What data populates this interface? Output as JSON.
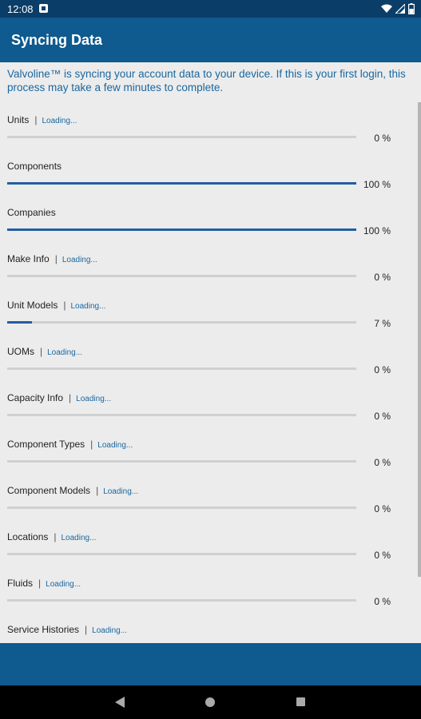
{
  "status": {
    "time": "12:08"
  },
  "header": {
    "title": "Syncing Data"
  },
  "intro": "Valvoline™ is syncing your account data to your device. If this is your first login, this process may take a few minutes to complete.",
  "colors": {
    "primary": "#0f5a8e",
    "status_bar": "#0a3d68",
    "progress": "#225ea1",
    "link_text": "#1a67a0"
  },
  "items": [
    {
      "name": "Units",
      "loading": "Loading...",
      "percent_text": "0 %",
      "progress": 0
    },
    {
      "name": "Components",
      "loading": "",
      "percent_text": "100 %",
      "progress": 100
    },
    {
      "name": "Companies",
      "loading": "",
      "percent_text": "100 %",
      "progress": 100
    },
    {
      "name": "Make Info",
      "loading": "Loading...",
      "percent_text": "0 %",
      "progress": 0
    },
    {
      "name": "Unit Models",
      "loading": "Loading...",
      "percent_text": "7 %",
      "progress": 7
    },
    {
      "name": "UOMs",
      "loading": "Loading...",
      "percent_text": "0 %",
      "progress": 0
    },
    {
      "name": "Capacity Info",
      "loading": "Loading...",
      "percent_text": "0 %",
      "progress": 0
    },
    {
      "name": "Component Types",
      "loading": "Loading...",
      "percent_text": "0 %",
      "progress": 0
    },
    {
      "name": "Component Models",
      "loading": "Loading...",
      "percent_text": "0 %",
      "progress": 0
    },
    {
      "name": "Locations",
      "loading": "Loading...",
      "percent_text": "0 %",
      "progress": 0
    },
    {
      "name": "Fluids",
      "loading": "Loading...",
      "percent_text": "0 %",
      "progress": 0
    },
    {
      "name": "Service Histories",
      "loading": "Loading...",
      "percent_text": "",
      "progress": 0
    }
  ]
}
